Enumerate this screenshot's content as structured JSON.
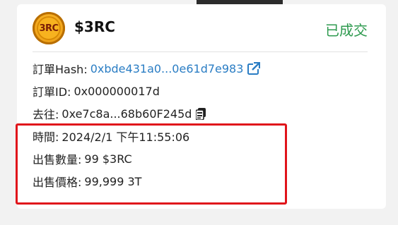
{
  "top_chip": {
    "text": "…"
  },
  "order": {
    "coin_logo_text": "3RC",
    "token": "$3RC",
    "status": "已成交",
    "status_color": "#2e9a4f",
    "link_color": "#2a7dc4",
    "fields": {
      "hash": {
        "label": "訂單Hash:",
        "value": "0xbde431a0...0e61d7e983",
        "icon": "external-link-icon"
      },
      "id": {
        "label": "訂單ID:",
        "value": "0x000000017d"
      },
      "to": {
        "label": "去往:",
        "value": "0xe7c8a...68b60F245d",
        "icon": "copy-icon"
      },
      "time": {
        "label": "時間:",
        "value": "2024/2/1 下午11:55:06"
      },
      "qty": {
        "label": "出售數量:",
        "value": "99 $3RC"
      },
      "price": {
        "label": "出售價格:",
        "value": "99,999 3T"
      }
    }
  },
  "highlight_color": "#e0141b"
}
